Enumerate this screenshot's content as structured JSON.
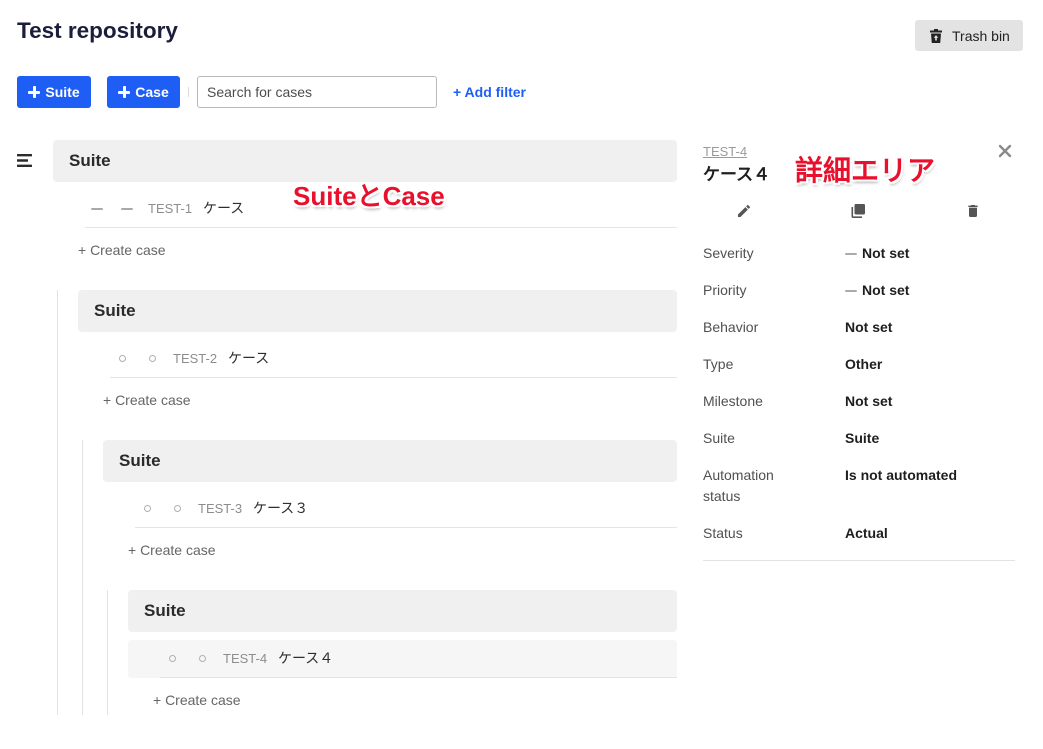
{
  "page": {
    "title": "Test repository"
  },
  "header": {
    "trash_bin": {
      "label": "Trash bin",
      "icon": "trash-restore-icon"
    }
  },
  "toolbar": {
    "add_suite": {
      "icon": "plus-icon",
      "label": "Suite"
    },
    "add_case": {
      "icon": "plus-icon",
      "label": "Case"
    },
    "search": {
      "placeholder": "Search for cases",
      "value": ""
    },
    "add_filter": {
      "label": "+ Add filter"
    }
  },
  "tree": {
    "toggle_icon": "tree-menu-icon",
    "suites": [
      {
        "name": "Suite",
        "cases": [
          {
            "id": "TEST-1",
            "title": "ケース",
            "icons": [
              "dash-icon",
              "dash-icon"
            ]
          }
        ],
        "create_case_label": "+ Create case",
        "suites": [
          {
            "name": "Suite",
            "cases": [
              {
                "id": "TEST-2",
                "title": "ケース",
                "icons": [
                  "circle-icon",
                  "circle-icon"
                ]
              }
            ],
            "create_case_label": "+ Create case",
            "suites": [
              {
                "name": "Suite",
                "cases": [
                  {
                    "id": "TEST-3",
                    "title": "ケース３",
                    "icons": [
                      "circle-icon",
                      "circle-icon"
                    ]
                  }
                ],
                "create_case_label": "+ Create case",
                "suites": [
                  {
                    "name": "Suite",
                    "cases": [
                      {
                        "id": "TEST-4",
                        "title": "ケース４",
                        "icons": [
                          "circle-icon",
                          "circle-icon"
                        ],
                        "selected": true
                      }
                    ],
                    "create_case_label": "+ Create case",
                    "suites": []
                  }
                ]
              }
            ]
          }
        ]
      }
    ]
  },
  "detail": {
    "case_id": "TEST-4",
    "case_title": "ケース４",
    "close_icon": "close-icon",
    "actions": [
      {
        "icon": "pencil-icon"
      },
      {
        "icon": "copy-icon"
      },
      {
        "icon": "trash-icon"
      }
    ],
    "fields": [
      {
        "label": "Severity",
        "value": "Not set",
        "icon": "dash-icon"
      },
      {
        "label": "Priority",
        "value": "Not set",
        "icon": "dash-icon"
      },
      {
        "label": "Behavior",
        "value": "Not set"
      },
      {
        "label": "Type",
        "value": "Other"
      },
      {
        "label": "Milestone",
        "value": "Not set"
      },
      {
        "label": "Suite",
        "value": "Suite"
      },
      {
        "label": "Automation status",
        "value": "Is not automated"
      },
      {
        "label": "Status",
        "value": "Actual"
      }
    ]
  },
  "annotations": [
    {
      "text": "SuiteとCase"
    },
    {
      "text": "詳細エリア"
    }
  ],
  "colors": {
    "accent": "#1f5ef5",
    "annotation": "#e8102c",
    "suite_header_bg": "#f0f0f0",
    "selected_row_bg": "#f6f6f6"
  }
}
